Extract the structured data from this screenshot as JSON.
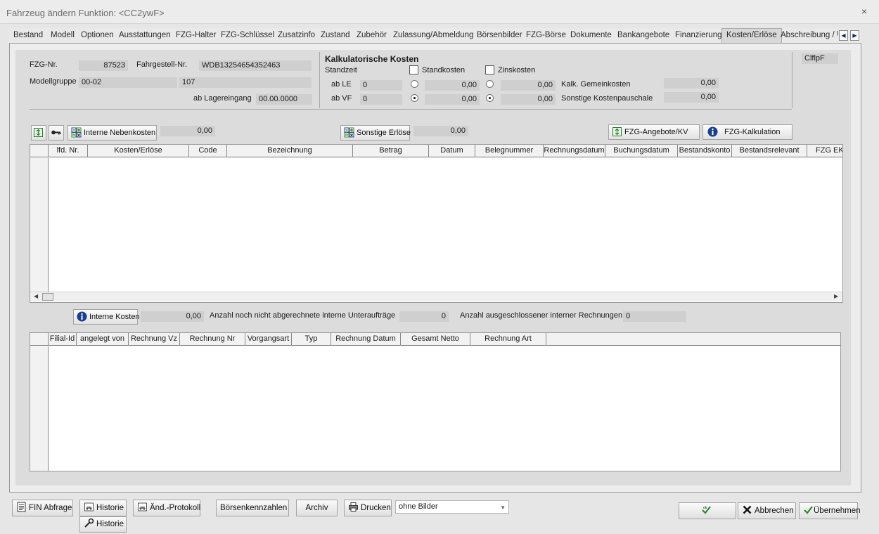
{
  "window": {
    "title": "Fahrzeug ändern   Funktion: <CC2ywF>",
    "close": "×"
  },
  "tabs": [
    "Bestand",
    "Modell",
    "Optionen",
    "Ausstattungen",
    "FZG-Halter",
    "FZG-Schlüssel",
    "Zusatzinfo",
    "Zustand",
    "Zubehör",
    "Zulassung/Abmeldung",
    "Börsenbilder",
    "FZG-Börse",
    "Dokumente",
    "Bankangebote",
    "Finanzierung",
    "Kosten/Erlöse",
    "Abschreibung / \\"
  ],
  "active_tab": "Kosten/Erlöse",
  "vehicle": {
    "fzg_nr_label": "FZG-Nr.",
    "fzg_nr": "87523",
    "fahrgestell_label": "Fahrgestell-Nr.",
    "fahrgestell": "WDB13254654352463",
    "modellgruppe_label": "Modellgruppe",
    "modellgruppe": "00-02",
    "modell": "107",
    "lagereingang_label": "ab Lagereingang",
    "lagereingang": "00.00.0000"
  },
  "kalk": {
    "heading": "Kalkulatorische Kosten",
    "standzeit": "Standzeit",
    "standkosten": "Standkosten",
    "zinskosten": "Zinskosten",
    "ab_le": "ab LE",
    "ab_le_val": "0",
    "ab_vf": "ab VF",
    "ab_vf_val": "0",
    "stand_le": "0,00",
    "stand_vf": "0,00",
    "zins_le": "0,00",
    "zins_vf": "0,00",
    "gemein_label": "Kalk. Gemeinkosten",
    "gemein": "0,00",
    "pauschale_label": "Sonstige Kostenpauschale",
    "pauschale": "0,00",
    "code": "ClflpF"
  },
  "toolbar1": {
    "interne_nebenkosten": "Interne Nebenkosten",
    "nebenkosten_val": "0,00",
    "sonstige_erloese": "Sonstige Erlöse",
    "erloese_val": "0,00",
    "angebote": "FZG-Angebote/KV",
    "kalkulation": "FZG-Kalkulation"
  },
  "grid1_cols": [
    "lfd. Nr.",
    "Kosten/Erlöse",
    "Code",
    "Bezeichnung",
    "Betrag",
    "Datum",
    "Belegnummer",
    "Rechnungsdatum",
    "Buchungsdatum",
    "Bestandskonto",
    "Bestandsrelevant",
    "FZG EK"
  ],
  "toolbar2": {
    "interne_kosten": "Interne Kosten",
    "interne_kosten_val": "0,00",
    "unterauftraege_label": "Anzahl noch nicht abgerechnete interne Unteraufträge",
    "unterauftraege": "0",
    "ausgeschlossen_label": "Anzahl ausgeschlossener interner Rechnungen",
    "ausgeschlossen": "0"
  },
  "grid2_cols": [
    "Filial-Id",
    "angelegt von",
    "Rechnung Vz",
    "Rechnung Nr",
    "Vorgangsart",
    "Typ",
    "Rechnung Datum",
    "Gesamt Netto",
    "Rechnung Art"
  ],
  "footer": {
    "fin_abfrage": "FIN Abfrage",
    "historie": "Historie",
    "aend_protokoll": "Änd.-Protokoll",
    "historie2": "Historie",
    "boersenkennzahlen": "Börsenkennzahlen",
    "archiv": "Archiv",
    "drucken": "Drucken",
    "druck_option": "ohne Bilder",
    "abbrechen": "Abbrechen",
    "uebernehmen": "Übernehmen"
  }
}
